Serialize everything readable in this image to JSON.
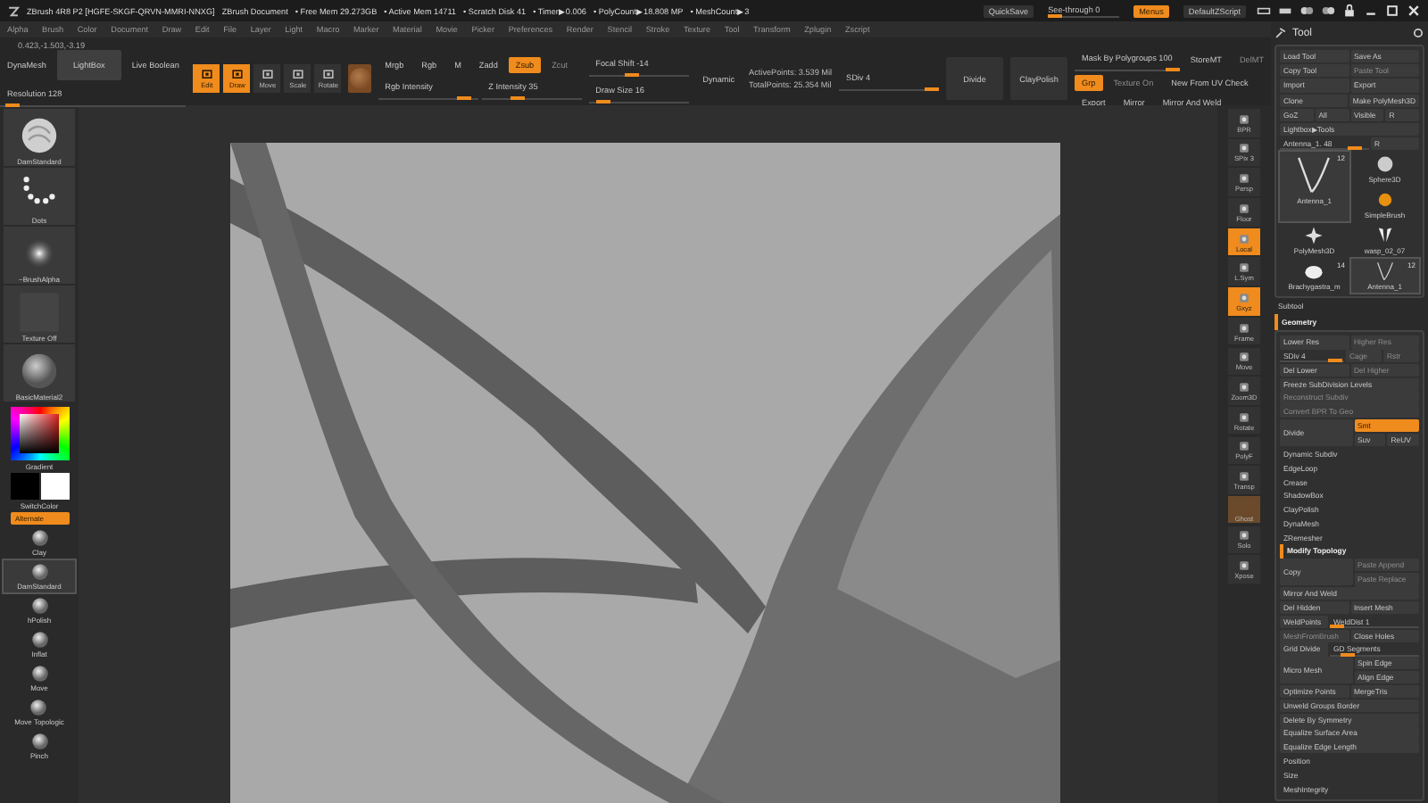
{
  "titlebar": {
    "title": "ZBrush 4R8 P2 [HGFE-SKGF-QRVN-MMRI-NNXG]",
    "document": "ZBrush Document",
    "stats": [
      "• Free Mem 29.273GB",
      "• Active Mem 14711",
      "• Scratch Disk 41",
      "• Timer▶0.006",
      "• PolyCount▶18.808 MP",
      "• MeshCount▶3"
    ],
    "controls": [
      {
        "kind": "button",
        "label": "QuickSave",
        "on": false,
        "disabled": false
      },
      {
        "kind": "slider",
        "label": "See-through  0",
        "level": 0
      },
      {
        "kind": "button",
        "label": "Menus",
        "on": true,
        "disabled": false
      },
      {
        "kind": "button",
        "label": "DefaultZScript",
        "on": false,
        "disabled": false
      }
    ]
  },
  "menu": [
    "Alpha",
    "Brush",
    "Color",
    "Document",
    "Draw",
    "Edit",
    "File",
    "Layer",
    "Light",
    "Macro",
    "Marker",
    "Material",
    "Movie",
    "Picker",
    "Preferences",
    "Render",
    "Stencil",
    "Stroke",
    "Texture",
    "Tool",
    "Transform",
    "Zplugin",
    "Zscript"
  ],
  "coordinates": "0.423,-1.503,-3.19",
  "shelf": [
    {
      "kind": "stack",
      "rows": [
        {
          "items": [
            {
              "kind": "button",
              "label": "DynaMesh",
              "on": false,
              "disabled": false
            },
            {
              "kind": "box",
              "label": "LightBox",
              "on": false,
              "disabled": false
            },
            {
              "kind": "button",
              "label": "Live Boolean",
              "on": false,
              "disabled": false
            }
          ]
        },
        {
          "items": [
            {
              "kind": "slider",
              "label": "Resolution 128",
              "level": 0.03
            }
          ]
        }
      ]
    },
    {
      "kind": "tools",
      "items": [
        {
          "label": "Edit",
          "on": true
        },
        {
          "label": "Draw",
          "on": true
        },
        {
          "label": "Move",
          "on": false
        },
        {
          "label": "Scale",
          "on": false
        },
        {
          "label": "Rotate",
          "on": false
        }
      ]
    },
    {
      "kind": "material"
    },
    {
      "kind": "stack",
      "rows": [
        {
          "items": [
            {
              "kind": "button",
              "label": "Mrgb",
              "on": false,
              "disabled": false
            },
            {
              "kind": "button",
              "label": "Rgb",
              "on": false,
              "disabled": false
            },
            {
              "kind": "button",
              "label": "M",
              "on": false,
              "disabled": false
            },
            {
              "kind": "button",
              "label": "Zadd",
              "on": false,
              "disabled": false
            },
            {
              "kind": "button",
              "label": "Zsub",
              "on": true,
              "disabled": false
            },
            {
              "kind": "button",
              "label": "Zcut",
              "on": false,
              "disabled": true
            }
          ]
        },
        {
          "items": [
            {
              "kind": "slider",
              "label": "Rgb Intensity",
              "level": 0.92
            },
            {
              "kind": "slider",
              "label": "Z Intensity 35",
              "level": 0.35
            }
          ]
        }
      ]
    },
    {
      "kind": "stack",
      "rows": [
        {
          "items": [
            {
              "kind": "slider",
              "label": "Focal Shift -14",
              "level": 0.43
            }
          ]
        },
        {
          "items": [
            {
              "kind": "slider",
              "label": "Draw Size 16",
              "level": 0.1
            }
          ]
        }
      ]
    },
    {
      "kind": "stack",
      "rows": [
        {
          "items": [
            {
              "kind": "button",
              "label": "Dynamic",
              "on": false,
              "disabled": false
            }
          ]
        }
      ]
    },
    {
      "kind": "stack",
      "rows": [
        {
          "items": [
            {
              "kind": "text",
              "label": "ActivePoints: 3.539 Mil"
            }
          ]
        },
        {
          "items": [
            {
              "kind": "text",
              "label": "TotalPoints: 25.354 Mil"
            }
          ]
        }
      ]
    },
    {
      "kind": "stack",
      "rows": [
        {
          "items": [
            {
              "kind": "slider",
              "label": "SDiv 4",
              "level": 1
            }
          ]
        }
      ]
    },
    {
      "kind": "tall",
      "label": "Divide",
      "on": false,
      "disabled": false
    },
    {
      "kind": "tall",
      "label": "ClayPolish",
      "on": false,
      "disabled": false
    },
    {
      "kind": "stack",
      "rows": [
        {
          "items": [
            {
              "kind": "slider",
              "label": "Mask By Polygroups 100",
              "level": 1
            },
            {
              "kind": "button",
              "label": "StoreMT",
              "on": false,
              "disabled": false
            },
            {
              "kind": "button",
              "label": "DelMT",
              "on": false,
              "disabled": true
            }
          ]
        },
        {
          "items": [
            {
              "kind": "button",
              "label": "Grp",
              "on": true,
              "disabled": false
            },
            {
              "kind": "button",
              "label": "Texture On",
              "on": false,
              "disabled": true
            },
            {
              "kind": "button",
              "label": "New From UV Check",
              "on": false,
              "disabled": false
            }
          ]
        },
        {
          "items": [
            {
              "kind": "button",
              "label": "Export",
              "on": false,
              "disabled": false
            },
            {
              "kind": "button",
              "label": "Mirror",
              "on": false,
              "disabled": false
            },
            {
              "kind": "button",
              "label": "Mirror And Weld",
              "on": false,
              "disabled": false
            }
          ]
        }
      ]
    }
  ],
  "left_panel": [
    {
      "kind": "brush",
      "label": "DamStandard"
    },
    {
      "kind": "stroke",
      "label": "Dots"
    },
    {
      "kind": "alpha",
      "label": "~BrushAlpha"
    },
    {
      "kind": "texture",
      "label": "Texture Off"
    },
    {
      "kind": "material",
      "label": "BasicMaterial2"
    },
    {
      "kind": "color",
      "label": "Gradient"
    },
    {
      "kind": "swatches",
      "label": "SwitchColor"
    },
    {
      "kind": "toggle",
      "label": "Alternate",
      "on": true
    }
  ],
  "brushes": [
    {
      "label": "Clay",
      "selected": false
    },
    {
      "label": "DamStandard",
      "selected": true
    },
    {
      "label": "hPolish",
      "selected": false
    },
    {
      "label": "Inflat",
      "selected": false
    },
    {
      "label": "Move",
      "selected": false
    },
    {
      "label": "Move Topologic",
      "selected": false
    },
    {
      "label": "Pinch",
      "selected": false
    }
  ],
  "view_shelf": [
    {
      "kind": "icon",
      "label": "BPR",
      "on": false
    },
    {
      "kind": "icon",
      "label": "SPix 3",
      "on": false
    },
    {
      "kind": "icon",
      "label": "Persp",
      "on": false
    },
    {
      "kind": "icon",
      "label": "Floor",
      "on": false
    },
    {
      "kind": "icon",
      "label": "Local",
      "on": true
    },
    {
      "kind": "icon",
      "label": "L.Sym",
      "on": false
    },
    {
      "kind": "icon",
      "label": "Gxyz",
      "on": true
    },
    {
      "kind": "icon",
      "label": "Frame",
      "on": false
    },
    {
      "kind": "icon",
      "label": "Move",
      "on": false
    },
    {
      "kind": "icon",
      "label": "Zoom3D",
      "on": false
    },
    {
      "kind": "icon",
      "label": "Rotate",
      "on": false
    },
    {
      "kind": "icon",
      "label": "PolyF",
      "on": false
    },
    {
      "kind": "icon",
      "label": "Transp",
      "on": false
    },
    {
      "kind": "swatch",
      "label": "Ghost",
      "on": false
    },
    {
      "kind": "icon",
      "label": "Solo",
      "on": false
    },
    {
      "kind": "icon",
      "label": "Xpose",
      "on": false
    }
  ],
  "tool_palette": {
    "title": "Tool",
    "rows": [
      {
        "kind": "row",
        "items": [
          {
            "kind": "button",
            "label": "Load Tool",
            "on": false,
            "disabled": false
          },
          {
            "kind": "button",
            "label": "Save As",
            "on": false,
            "disabled": false
          }
        ]
      },
      {
        "kind": "row",
        "items": [
          {
            "kind": "button",
            "label": "Copy Tool",
            "on": false,
            "disabled": false
          },
          {
            "kind": "button",
            "label": "Paste Tool",
            "on": false,
            "disabled": true
          }
        ]
      },
      {
        "kind": "row",
        "items": [
          {
            "kind": "button",
            "label": "Import",
            "on": false,
            "disabled": false
          },
          {
            "kind": "button",
            "label": "Export",
            "on": false,
            "disabled": false
          }
        ]
      },
      {
        "kind": "row",
        "items": [
          {
            "kind": "button",
            "label": "Clone",
            "on": false,
            "disabled": false
          },
          {
            "kind": "button",
            "label": "Make PolyMesh3D",
            "on": false,
            "disabled": false
          }
        ]
      },
      {
        "kind": "row",
        "items": [
          {
            "kind": "button",
            "label": "GoZ",
            "on": false,
            "disabled": false
          },
          {
            "kind": "button",
            "label": "All",
            "on": false,
            "disabled": false
          },
          {
            "kind": "button",
            "label": "Visible",
            "on": false,
            "disabled": false
          },
          {
            "kind": "button",
            "label": "R",
            "on": false,
            "disabled": false
          }
        ]
      },
      {
        "kind": "row",
        "items": [
          {
            "kind": "button",
            "label": "Lightbox▶Tools",
            "on": false,
            "disabled": false
          }
        ]
      },
      {
        "kind": "row",
        "items": [
          {
            "kind": "slider",
            "label": "Antenna_1. 48",
            "level": 0.9
          },
          {
            "kind": "button",
            "label": "R",
            "on": false,
            "disabled": false
          }
        ]
      },
      {
        "kind": "thumbs",
        "items": [
          {
            "kind": "curve",
            "label": "Antenna_1",
            "count": "12",
            "selected": true
          },
          {
            "kind": "sphere",
            "label": "Sphere3D",
            "selected": false
          },
          {
            "kind": "brush",
            "label": "SimpleBrush",
            "selected": false
          },
          {
            "kind": "star",
            "label": "PolyMesh3D",
            "selected": false
          },
          {
            "kind": "wings",
            "label": "wasp_02_07",
            "selected": false
          },
          {
            "kind": "blob",
            "label": "Brachygastra_m",
            "count": "14",
            "selected": false
          },
          {
            "kind": "curve",
            "label": "Antenna_1",
            "count": "12",
            "selected": true
          }
        ]
      }
    ],
    "sections": [
      {
        "label": "Subtool",
        "expanded": false
      },
      {
        "label": "Geometry",
        "expanded": true
      }
    ],
    "geometry": [
      {
        "kind": "row",
        "items": [
          {
            "kind": "button",
            "label": "Lower Res",
            "on": false,
            "disabled": false
          },
          {
            "kind": "button",
            "label": "Higher Res",
            "on": false,
            "disabled": true
          }
        ]
      },
      {
        "kind": "row",
        "items": [
          {
            "kind": "slider",
            "label": "SDiv 4",
            "level": 0.95
          },
          {
            "kind": "button",
            "label": "Cage",
            "on": false,
            "disabled": true
          },
          {
            "kind": "button",
            "label": "Rstr",
            "on": false,
            "disabled": true
          }
        ]
      },
      {
        "kind": "row",
        "items": [
          {
            "kind": "button",
            "label": "Del Lower",
            "on": false,
            "disabled": false
          },
          {
            "kind": "button",
            "label": "Del Higher",
            "on": false,
            "disabled": true
          }
        ]
      },
      {
        "kind": "row",
        "items": [
          {
            "kind": "button",
            "label": "Freeze SubDivision Levels",
            "on": false,
            "disabled": false
          }
        ]
      },
      {
        "kind": "row",
        "items": [
          {
            "kind": "button",
            "label": "Reconstruct Subdiv",
            "on": false,
            "disabled": true
          }
        ]
      },
      {
        "kind": "row",
        "items": [
          {
            "kind": "button",
            "label": "Convert BPR To Geo",
            "on": false,
            "disabled": true
          }
        ]
      },
      {
        "kind": "split",
        "left": {
          "label": "Divide",
          "on": false,
          "disabled": false
        },
        "right": [
          {
            "items": [
              {
                "kind": "button",
                "label": "Smt",
                "on": true,
                "disabled": false
              }
            ]
          },
          {
            "items": [
              {
                "kind": "button",
                "label": "Suv",
                "on": false,
                "disabled": false
              },
              {
                "kind": "button",
                "label": "ReUV",
                "on": false,
                "disabled": false
              }
            ]
          }
        ]
      },
      {
        "kind": "section",
        "label": "Dynamic Subdiv",
        "expanded": false
      },
      {
        "kind": "section",
        "label": "EdgeLoop",
        "expanded": false
      },
      {
        "kind": "section",
        "label": "Crease",
        "expanded": false
      },
      {
        "kind": "section",
        "label": "ShadowBox",
        "expanded": false
      },
      {
        "kind": "section",
        "label": "ClayPolish",
        "expanded": false
      },
      {
        "kind": "section",
        "label": "DynaMesh",
        "expanded": false
      },
      {
        "kind": "section",
        "label": "ZRemesher",
        "expanded": false
      },
      {
        "kind": "section",
        "label": "Modify Topology",
        "expanded": true
      },
      {
        "kind": "split",
        "left": {
          "label": "Copy",
          "on": false,
          "disabled": false
        },
        "right": [
          {
            "items": [
              {
                "kind": "button",
                "label": "Paste Append",
                "on": false,
                "disabled": true
              }
            ]
          },
          {
            "items": [
              {
                "kind": "button",
                "label": "Paste Replace",
                "on": false,
                "disabled": true
              }
            ]
          }
        ]
      },
      {
        "kind": "row",
        "items": [
          {
            "kind": "button",
            "label": "Mirror And Weld",
            "on": false,
            "disabled": false
          }
        ]
      },
      {
        "kind": "row",
        "items": [
          {
            "kind": "button",
            "label": "Del Hidden",
            "on": false,
            "disabled": false
          },
          {
            "kind": "button",
            "label": "Insert Mesh",
            "on": false,
            "disabled": false
          }
        ]
      },
      {
        "kind": "row",
        "items": [
          {
            "kind": "button",
            "label": "WeldPoints",
            "on": false,
            "disabled": false
          },
          {
            "kind": "slider",
            "label": "WeldDist 1",
            "level": 0
          }
        ]
      },
      {
        "kind": "row",
        "items": [
          {
            "kind": "button",
            "label": "MeshFromBrush",
            "on": false,
            "disabled": true
          },
          {
            "kind": "button",
            "label": "Close Holes",
            "on": false,
            "disabled": false
          }
        ]
      },
      {
        "kind": "row",
        "items": [
          {
            "kind": "button",
            "label": "Grid Divide",
            "on": false,
            "disabled": false
          },
          {
            "kind": "slider",
            "label": "GD Segments",
            "level": 0.15
          }
        ]
      },
      {
        "kind": "split",
        "left": {
          "label": "Micro Mesh",
          "on": false,
          "disabled": false
        },
        "right": [
          {
            "items": [
              {
                "kind": "button",
                "label": "Spin Edge",
                "on": false,
                "disabled": false
              }
            ]
          },
          {
            "items": [
              {
                "kind": "button",
                "label": "Align Edge",
                "on": false,
                "disabled": false
              }
            ]
          }
        ]
      },
      {
        "kind": "row",
        "items": [
          {
            "kind": "button",
            "label": "Optimize Points",
            "on": false,
            "disabled": false
          },
          {
            "kind": "button",
            "label": "MergeTris",
            "on": false,
            "disabled": false
          }
        ]
      },
      {
        "kind": "row",
        "items": [
          {
            "kind": "button",
            "label": "Unweld Groups Border",
            "on": false,
            "disabled": false
          }
        ]
      },
      {
        "kind": "row",
        "items": [
          {
            "kind": "button",
            "label": "Delete By Symmetry",
            "on": false,
            "disabled": false
          }
        ]
      },
      {
        "kind": "row",
        "items": [
          {
            "kind": "button",
            "label": "Equalize Surface Area",
            "on": false,
            "disabled": false
          }
        ]
      },
      {
        "kind": "row",
        "items": [
          {
            "kind": "button",
            "label": "Equalize Edge Length",
            "on": false,
            "disabled": false
          }
        ]
      },
      {
        "kind": "section",
        "label": "Position",
        "expanded": false
      },
      {
        "kind": "section",
        "label": "Size",
        "expanded": false
      },
      {
        "kind": "section",
        "label": "MeshIntegrity",
        "expanded": false
      }
    ]
  }
}
